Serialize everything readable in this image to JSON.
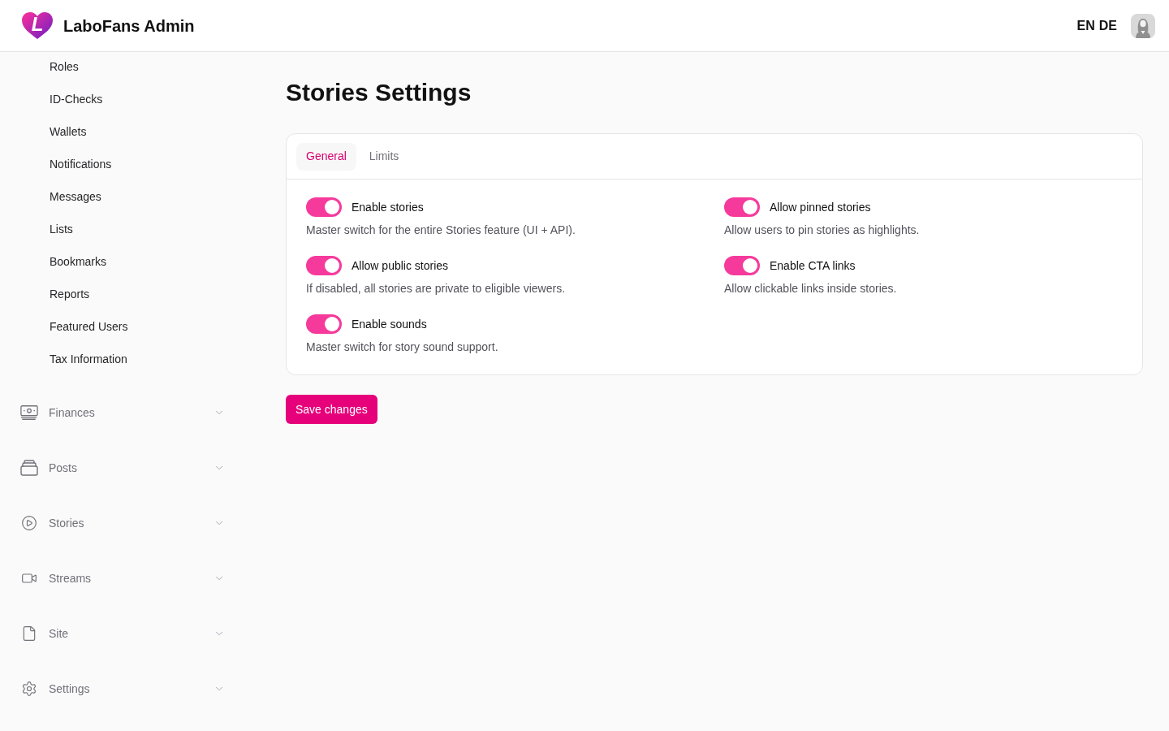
{
  "header": {
    "logo_letter": "L",
    "brand": "LaboFans Admin",
    "languages": [
      {
        "label": "EN"
      },
      {
        "label": "DE"
      }
    ]
  },
  "sidebar": {
    "sub_items": [
      "Roles",
      "ID-Checks",
      "Wallets",
      "Notifications",
      "Messages",
      "Lists",
      "Bookmarks",
      "Reports",
      "Featured Users",
      "Tax Information"
    ],
    "groups": [
      {
        "label": "Finances",
        "expanded": false
      },
      {
        "label": "Posts",
        "expanded": false
      },
      {
        "label": "Stories",
        "expanded": false
      },
      {
        "label": "Streams",
        "expanded": false
      },
      {
        "label": "Site",
        "expanded": false
      },
      {
        "label": "Settings",
        "expanded": false
      }
    ]
  },
  "page": {
    "title": "Stories Settings",
    "tabs": [
      {
        "label": "General",
        "selected": true
      },
      {
        "label": "Limits",
        "selected": false
      }
    ],
    "settings": [
      {
        "label": "Enable stories",
        "description": "Master switch for the entire Stories feature (UI + API).",
        "on": true
      },
      {
        "label": "Allow pinned stories",
        "description": "Allow users to pin stories as highlights.",
        "on": true
      },
      {
        "label": "Allow public stories",
        "description": "If disabled, all stories are private to eligible viewers.",
        "on": true
      },
      {
        "label": "Enable CTA links",
        "description": "Allow clickable links inside stories.",
        "on": true
      },
      {
        "label": "Enable sounds",
        "description": "Master switch for story sound support.",
        "on": true
      }
    ],
    "save_button": "Save changes"
  }
}
